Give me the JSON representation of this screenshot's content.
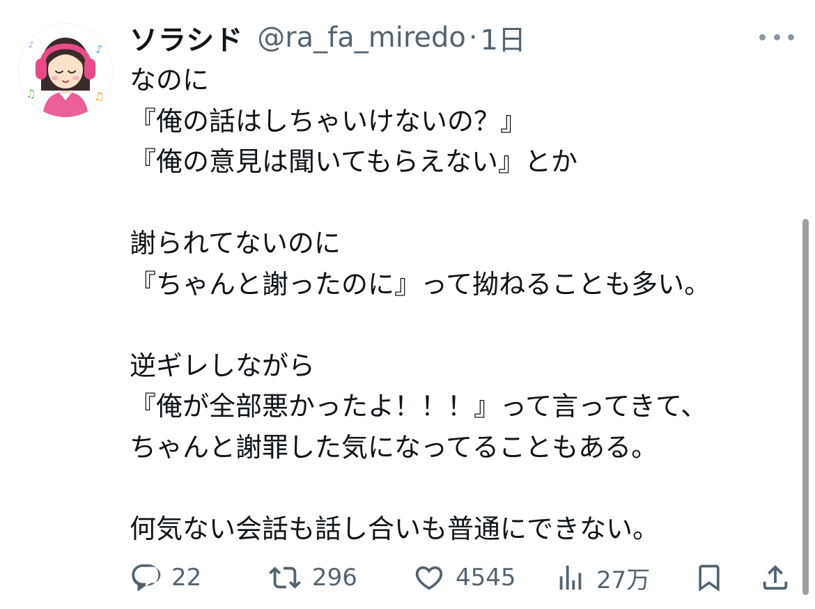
{
  "author": {
    "display_name": "ソラシド",
    "handle": "@ra_fa_miredo",
    "separator": "·",
    "timestamp": "1日",
    "avatar_icon": "girl-with-headphones-avatar"
  },
  "more_icon": "more-horizontal-icon",
  "body_lines": [
    "なのに",
    "『俺の話はしちゃいけないの？』",
    "『俺の意見は聞いてもらえない』とか",
    "",
    "謝られてないのに",
    "『ちゃんと謝ったのに』って拗ねることも多い。",
    "",
    "逆ギレしながら",
    "『俺が全部悪かったよ！！！』って言ってきて、",
    "ちゃんと謝罪した気になってることもある。",
    "",
    "何気ない会話も話し合いも普通にできない。"
  ],
  "actions": {
    "reply": {
      "icon": "reply-icon",
      "count": "22"
    },
    "retweet": {
      "icon": "retweet-icon",
      "count": "296"
    },
    "like": {
      "icon": "heart-icon",
      "count": "4545"
    },
    "views": {
      "icon": "views-bar-chart-icon",
      "count": "27万"
    },
    "bookmark": {
      "icon": "bookmark-icon"
    },
    "share": {
      "icon": "share-icon"
    }
  },
  "colors": {
    "text": "#0f1419",
    "secondary": "#536471",
    "avatar_pink": "#e94b8a"
  }
}
